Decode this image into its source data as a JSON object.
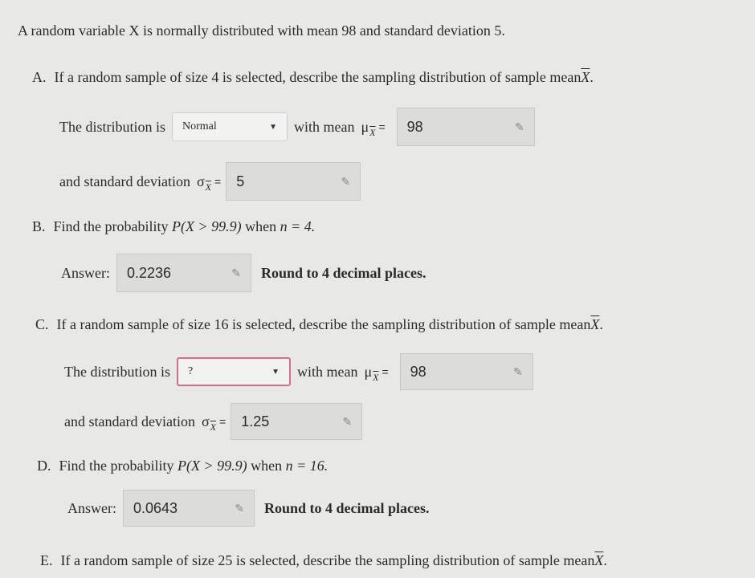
{
  "intro": "A random variable X is normally distributed with mean 98 and standard deviation 5.",
  "parts": [
    {
      "letter": "A.",
      "question_pre": "If a random sample of size 4 is selected, describe the sampling distribution of sample mean ",
      "question_var": "X",
      "dist_label": "The distribution is",
      "dist_value": "Normal",
      "mean_label": "with mean",
      "mean_value": "98",
      "sd_label": "and standard deviation",
      "sd_value": "5"
    },
    {
      "letter": "B.",
      "prob_pre": "Find the probability",
      "prob_expr": "P(X > 99.9)",
      "prob_when": "when",
      "prob_n": "n = 4.",
      "answer_label": "Answer:",
      "answer_value": "0.2236",
      "round_note": "Round to 4 decimal places."
    },
    {
      "letter": "C.",
      "question_pre": "If a random sample of size 16 is selected, describe the sampling distribution of sample mean ",
      "question_var": "X",
      "dist_label": "The distribution is",
      "dist_value": "?",
      "mean_label": "with mean",
      "mean_value": "98",
      "sd_label": "and standard deviation",
      "sd_value": "1.25"
    },
    {
      "letter": "D.",
      "prob_pre": "Find the probability",
      "prob_expr": "P(X > 99.9)",
      "prob_when": "when",
      "prob_n": "n = 16.",
      "answer_label": "Answer:",
      "answer_value": "0.0643",
      "round_note": "Round to 4 decimal places."
    },
    {
      "letter": "E.",
      "question_pre": "If a random sample of size 25 is selected, describe the sampling distribution of sample mean ",
      "question_var": "X"
    }
  ],
  "colors": {
    "error_border": "#d07090",
    "input_bg": "#dcdcd8"
  },
  "icons": {
    "dropdown": "caret-down-icon",
    "edit": "pencil-icon"
  }
}
